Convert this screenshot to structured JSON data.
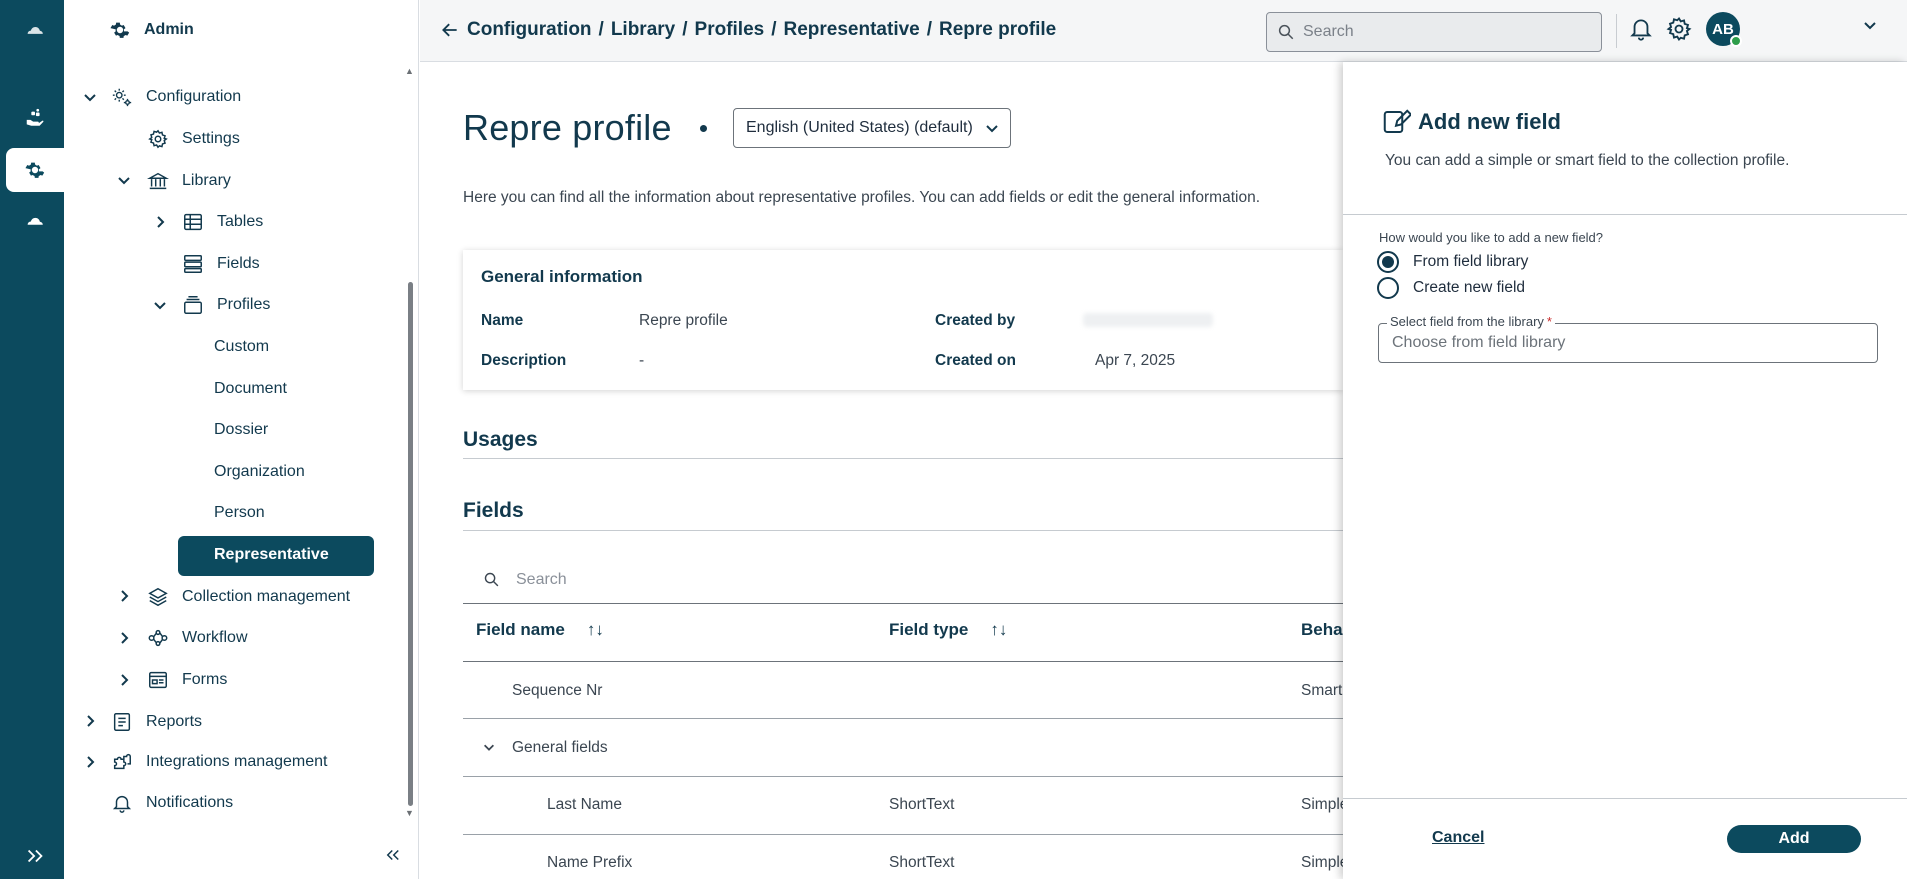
{
  "nav": {
    "header": "Admin",
    "items": {
      "configuration": "Configuration",
      "settings": "Settings",
      "library": "Library",
      "tables": "Tables",
      "fields": "Fields",
      "profiles": "Profiles",
      "custom": "Custom",
      "document": "Document",
      "dossier": "Dossier",
      "organization": "Organization",
      "person": "Person",
      "representative": "Representative",
      "collection_management": "Collection management",
      "workflow": "Workflow",
      "forms": "Forms",
      "reports": "Reports",
      "integrations_management": "Integrations management",
      "notifications": "Notifications"
    }
  },
  "topbar": {
    "breadcrumb": [
      "Configuration",
      "Library",
      "Profiles",
      "Representative",
      "Repre profile"
    ],
    "separator": "/",
    "search_placeholder": "Search",
    "avatar_initials": "AB"
  },
  "page": {
    "title": "Repre profile",
    "language": "English (United States) (default)",
    "description": "Here you can find all the information about representative profiles. You can add fields or edit the general information.",
    "general_info": {
      "title": "General information",
      "name_label": "Name",
      "name_value": "Repre profile",
      "description_label": "Description",
      "description_value": "-",
      "created_by_label": "Created by",
      "created_on_label": "Created on",
      "created_on_value": "Apr 7, 2025"
    },
    "usages_title": "Usages",
    "fields_title": "Fields",
    "fields_search_placeholder": "Search",
    "table": {
      "headers": {
        "field_name": "Field name",
        "field_type": "Field type",
        "behavior": "Beha"
      },
      "sort_glyph": "↑↓",
      "rows": [
        {
          "name": "Sequence Nr",
          "type": "",
          "behavior": "Smart"
        },
        {
          "name": "General fields",
          "type": "",
          "behavior": ""
        },
        {
          "name": "Last Name",
          "type": "ShortText",
          "behavior": "Simple"
        },
        {
          "name": "Name Prefix",
          "type": "ShortText",
          "behavior": "Simple"
        }
      ]
    }
  },
  "drawer": {
    "title": "Add new field",
    "subtitle": "You can add a simple or smart field to the collection profile.",
    "question": "How would you like to add a new field?",
    "option_library": "From field library",
    "option_new": "Create new field",
    "selected_option": "From field library",
    "select_label": "Select field from the library",
    "required_mark": "*",
    "select_placeholder": "Choose from field library",
    "cancel": "Cancel",
    "add": "Add"
  },
  "colors": {
    "brand": "#0c4a5e",
    "text_dark": "#12394d",
    "required": "#c92a2a",
    "online": "#2e9e4b"
  }
}
